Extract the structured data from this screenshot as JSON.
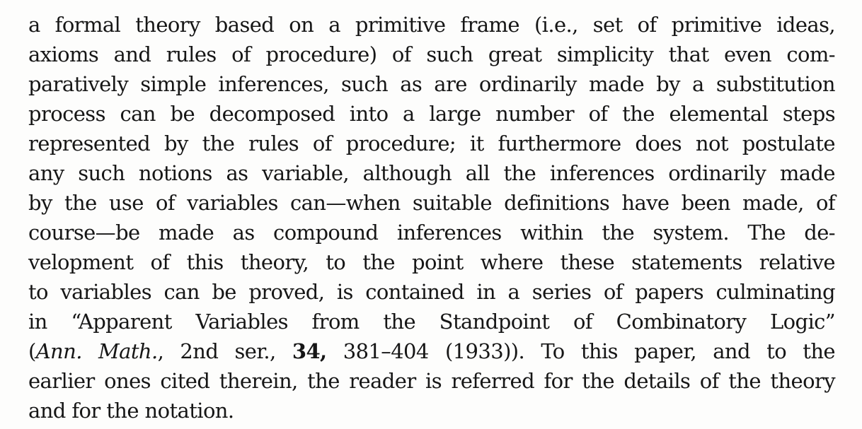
{
  "document": {
    "paragraph": {
      "line_01": "a formal theory based on a primitive frame (i.e., set of primitive ideas,",
      "line_02": "axioms and rules of procedure) of such great simplicity that even com-",
      "line_03": "paratively simple inferences, such as are ordinarily made by a substitution",
      "line_04": "process can be decomposed into a large number of the elemental steps",
      "line_05": "represented by the rules of procedure; it furthermore does not postulate",
      "line_06": "any such notions as variable, although all the inferences ordinarily made",
      "line_07": "by the use of variables can—when suitable definitions have been made, of",
      "line_08": "course—be made as compound inferences within the system.  The de-",
      "line_09": "velopment of this theory, to the point where these statements relative",
      "line_10": "to variables can be proved, is contained in a series of papers culminating",
      "line_11": "in “Apparent Variables from the Standpoint of Combinatory Logic”",
      "line_12": {
        "open_paren": "(",
        "journal": "Ann. Math.",
        "series": ", 2nd ser., ",
        "volume": "34,",
        "pages_year": " 381–404 (1933)).  To this paper, and to the"
      },
      "line_13": "earlier ones cited therein, the reader is referred for the details of the theory",
      "line_14": "and for the notation."
    }
  }
}
